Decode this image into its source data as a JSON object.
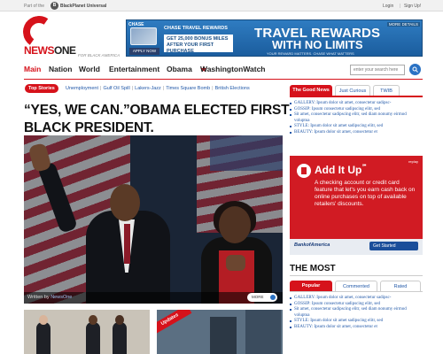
{
  "topbar": {
    "part_of": "Part of the",
    "network_name": "BlackPlanet Universal",
    "login": "Login",
    "signup": "Sign Up!"
  },
  "logo": {
    "news": "NEWS",
    "one": "ONE",
    "tagline": "FOR BLACK AMERICA"
  },
  "banner_ad": {
    "brand": "CHASE",
    "line1": "CHASE TRAVEL REWARDS",
    "line2": "GET 25,000 BONUS MILES AFTER YOUR FIRST PURCHASE",
    "apply": "APPLY NOW",
    "headline1": "TRAVEL REWARDS",
    "headline2": "WITH NO LIMITS",
    "fine": "YOUR REWARD MATTERS. CHASE WHAT MATTERS",
    "more": "MORE DETAILS"
  },
  "nav": {
    "items": [
      "Main",
      "Nation",
      "World",
      "Entertainment",
      "Obama",
      "WashingtonWatch"
    ],
    "search_placeholder": "enter your search here"
  },
  "top_stories": {
    "label": "Top Stories",
    "links": [
      "Unemployment",
      "Gulf Oil Spill",
      "Lakers-Jazz",
      "Times Square Bomb",
      "British Elections"
    ]
  },
  "headline": "“YES, WE CAN.”OBAMA ELECTED FIRST BLACK PRESIDENT.",
  "hero": {
    "caption_prefix": "Written by",
    "caption_author": "NewsOne",
    "more": "MORE"
  },
  "thumbs": {
    "updates_label": "Updates"
  },
  "right_tabs": {
    "tabs": [
      "The Good News",
      "Just Curious",
      "TWIB"
    ],
    "items": [
      {
        "cat": "GALLERY:",
        "text": "Ipsum dolor sit amet, consectetur sadipsc-"
      },
      {
        "cat": "GOSSIP:",
        "text": "Ipsum consectetur sadipscing elitr, sed"
      },
      {
        "cat": "",
        "text": "Sit amet, consectetur sadipscing elitr, sed diam nonumy eirmod voluptua"
      },
      {
        "cat": "STYLE:",
        "text": "Ipsum dolor sit amet sadipscing elitr, sed"
      },
      {
        "cat": "BEAUTY:",
        "text": "Ipsum dolor sit amet, consectetur et"
      }
    ]
  },
  "side_ad": {
    "title": "Add It Up",
    "tm": "℠",
    "replay": "replay",
    "body": "A checking account or credit card feature that let's you earn cash back on online purchases on top of available retailers' discounts.",
    "brand": "BankofAmerica",
    "cta": "Get Started"
  },
  "the_most": {
    "title": "THE MOST",
    "tabs": [
      "Popular",
      "Commented",
      "Rated"
    ],
    "items": [
      {
        "cat": "GALLERY:",
        "text": "Ipsum dolor sit amet, consectetur sadipsc-"
      },
      {
        "cat": "GOSSIP:",
        "text": "Ipsum consectetur sadipscing elitr, sed"
      },
      {
        "cat": "",
        "text": "Sit amet, consectetur sadipscing elitr, sed diam nonumy eirmod voluptua"
      },
      {
        "cat": "STYLE:",
        "text": "Ipsum dolor sit amet sadipscing elitr, sed"
      },
      {
        "cat": "BEAUTY:",
        "text": "Ipsum dolor sit amet, consectetur et"
      }
    ]
  },
  "colors": {
    "brand_red": "#d6121b",
    "link_blue": "#2158a8",
    "search_button": "#2a72c4"
  },
  "icons": [
    "blackplanet-logo-icon",
    "search-icon",
    "star-icon",
    "arrow-right-icon",
    "bank-icon"
  ]
}
